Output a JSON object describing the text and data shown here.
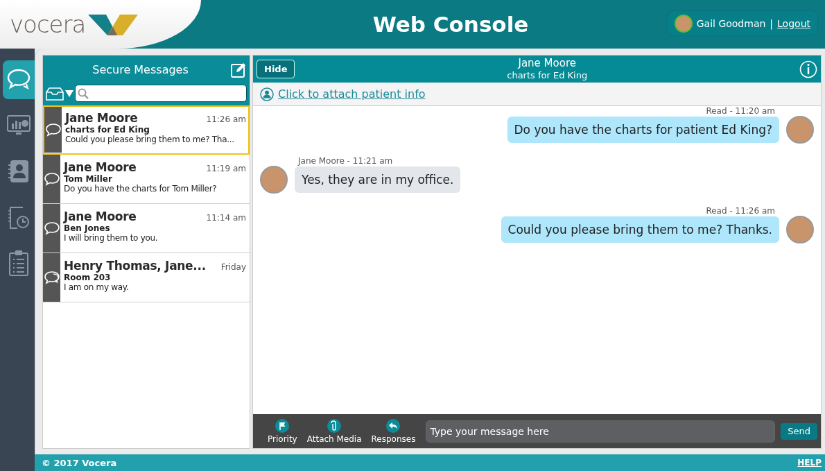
{
  "header": {
    "logo_text": "vocera",
    "title": "Web Console",
    "user": {
      "name": "Gail Goodman",
      "separator": "|",
      "logout": "Logout"
    }
  },
  "nav": [
    {
      "kind": "chat",
      "selected": true
    },
    {
      "kind": "dashboard",
      "selected": false
    },
    {
      "kind": "contacts",
      "selected": false
    },
    {
      "kind": "history",
      "selected": false
    },
    {
      "kind": "clipboard",
      "selected": false
    }
  ],
  "messages_panel": {
    "title": "Secure Messages"
  },
  "conversations": [
    {
      "kind": "single",
      "name": "Jane Moore",
      "time": "11:26 am",
      "subject": "charts for Ed King",
      "preview": "Could you please bring them to me? Tha...",
      "selected": true
    },
    {
      "kind": "single",
      "name": "Jane Moore",
      "time": "11:19 am",
      "subject": "Tom Miller",
      "preview": "Do you have the charts for Tom Miller?",
      "selected": false
    },
    {
      "kind": "single",
      "name": "Jane Moore",
      "time": "11:14 am",
      "subject": "Ben Jones",
      "preview": "I will bring them to you.",
      "selected": false
    },
    {
      "kind": "group",
      "name": "Henry Thomas, Jane...",
      "time": "Friday",
      "subject": "Room 203",
      "preview": "I am on my way.",
      "selected": false
    }
  ],
  "chat": {
    "hide_button": "Hide",
    "title": "Jane Moore",
    "subtitle": "charts for Ed King",
    "attach_link": "Click to attach patient info"
  },
  "chat_messages": [
    {
      "kind": "outgoing",
      "meta": "Read - 11:20 am",
      "text": "Do you have the charts for patient Ed King?"
    },
    {
      "kind": "incoming",
      "meta": "Jane Moore - 11:21 am",
      "text": "Yes, they are in my office."
    },
    {
      "kind": "outgoing",
      "meta": "Read - 11:26 am",
      "text": "Could you please bring them to me? Thanks."
    }
  ],
  "composer": {
    "actions": [
      {
        "kind": "flag",
        "label": "Priority"
      },
      {
        "kind": "clip",
        "label": "Attach Media"
      },
      {
        "kind": "reply",
        "label": "Responses"
      }
    ],
    "placeholder": "Type your message here",
    "send": "Send"
  },
  "footer": {
    "copyright": "© 2017 Vocera",
    "help": "HELP"
  }
}
